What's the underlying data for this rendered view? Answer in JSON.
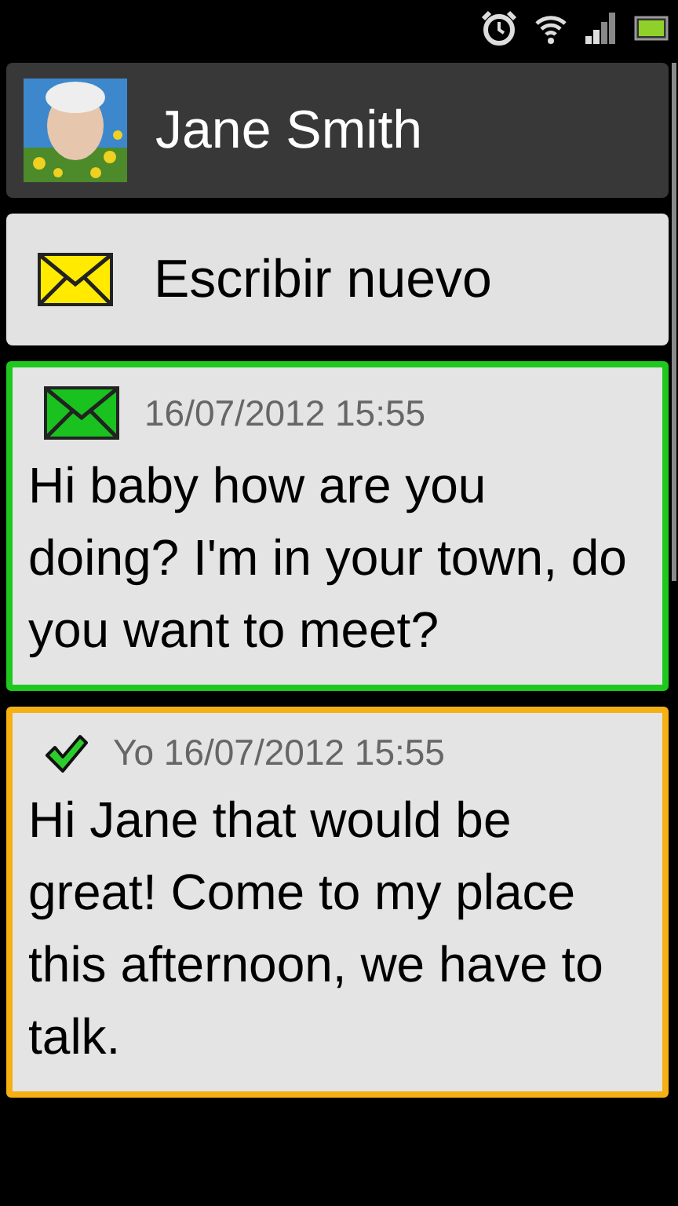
{
  "contact": {
    "name": "Jane Smith"
  },
  "compose_button": {
    "label": "Escribir nuevo"
  },
  "messages": [
    {
      "kind": "received",
      "color": "#1ec81e",
      "header": "16/07/2012 15:55",
      "text": "Hi baby how are you doing? I'm in your town, do you want to meet?"
    },
    {
      "kind": "sent",
      "color": "#f5b014",
      "header": "Yo 16/07/2012 15:55",
      "text": "Hi Jane that would be great! Come to my place this afternoon, we have to talk."
    }
  ]
}
